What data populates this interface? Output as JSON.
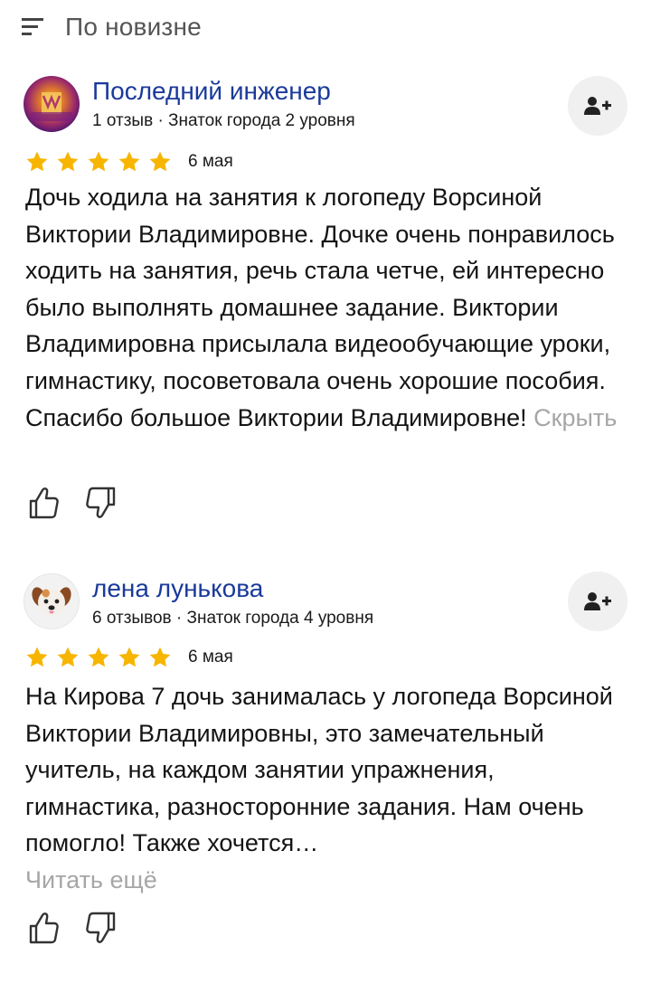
{
  "sort": {
    "label": "По новизне",
    "icon": "sort-lines-icon"
  },
  "accent_star": "#f7b500",
  "reviews": [
    {
      "author": "Последний инженер",
      "meta": "1 отзыв · Знаток города 2 уровня",
      "avatar": "avatar-photo",
      "rating": 5,
      "date": "6 мая",
      "text": "Дочь ходила на занятия к логопеду Ворсиной Виктории Владимировне. Дочке очень понравилось ходить на занятия, речь стала четче, ей интересно было выполнять домашнее задание. Виктории Владимировна присылала видеообучающие уроки, гимнастику, посоветовала очень хорошие пособия. Спасибо большое Виктории Владимировне!",
      "toggle_label": "Скрыть"
    },
    {
      "author": "лена лунькова",
      "meta": "6 отзывов · Знаток города 4 уровня",
      "avatar": "dog-avatar",
      "rating": 5,
      "date": "6 мая",
      "text": "На Кирова 7 дочь занималась у логопеда Ворсиной Виктории Владимировны, это замечательный учитель, на каждом занятии упражнения, гимнастика, разносторонние задания. Нам очень помогло! Также хочется…",
      "toggle_label": "Читать ещё"
    }
  ]
}
